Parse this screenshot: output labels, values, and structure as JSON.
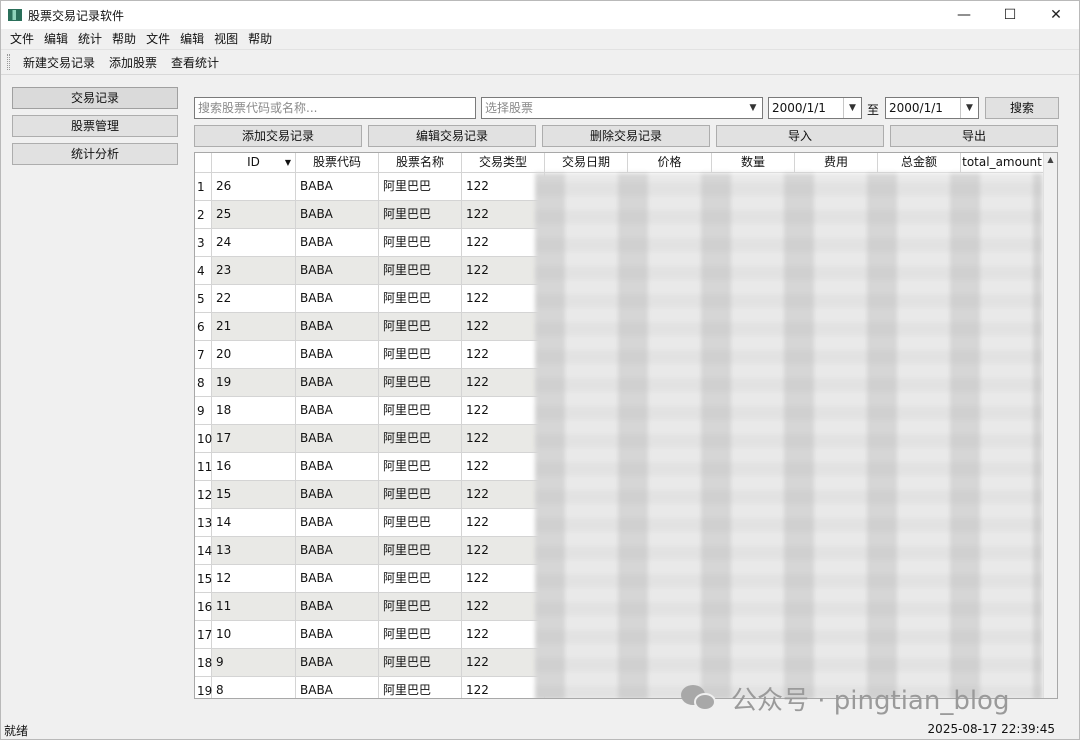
{
  "window": {
    "title": "股票交易记录软件",
    "minimize": "—",
    "maximize": "☐",
    "close": "✕"
  },
  "menubar": [
    "文件",
    "编辑",
    "统计",
    "帮助",
    "文件",
    "编辑",
    "视图",
    "帮助"
  ],
  "toolbar": [
    "新建交易记录",
    "添加股票",
    "查看统计"
  ],
  "sidebar": [
    "交易记录",
    "股票管理",
    "统计分析"
  ],
  "search": {
    "placeholder": "搜索股票代码或名称...",
    "stock_select_placeholder": "选择股票",
    "date_from": "2000/1/1",
    "to_label": "至",
    "date_to": "2000/1/1",
    "search_button": "搜索"
  },
  "actions": [
    "添加交易记录",
    "编辑交易记录",
    "删除交易记录",
    "导入",
    "导出"
  ],
  "table": {
    "columns": [
      "ID",
      "股票代码",
      "股票名称",
      "交易类型",
      "交易日期",
      "价格",
      "数量",
      "费用",
      "总金额",
      "total_amount"
    ],
    "sort_indicator": "▼",
    "rows": [
      {
        "n": "1",
        "id": "26",
        "code": "BABA",
        "name": "阿里巴巴",
        "type": "122"
      },
      {
        "n": "2",
        "id": "25",
        "code": "BABA",
        "name": "阿里巴巴",
        "type": "122"
      },
      {
        "n": "3",
        "id": "24",
        "code": "BABA",
        "name": "阿里巴巴",
        "type": "122"
      },
      {
        "n": "4",
        "id": "23",
        "code": "BABA",
        "name": "阿里巴巴",
        "type": "122"
      },
      {
        "n": "5",
        "id": "22",
        "code": "BABA",
        "name": "阿里巴巴",
        "type": "122"
      },
      {
        "n": "6",
        "id": "21",
        "code": "BABA",
        "name": "阿里巴巴",
        "type": "122"
      },
      {
        "n": "7",
        "id": "20",
        "code": "BABA",
        "name": "阿里巴巴",
        "type": "122"
      },
      {
        "n": "8",
        "id": "19",
        "code": "BABA",
        "name": "阿里巴巴",
        "type": "122"
      },
      {
        "n": "9",
        "id": "18",
        "code": "BABA",
        "name": "阿里巴巴",
        "type": "122"
      },
      {
        "n": "10",
        "id": "17",
        "code": "BABA",
        "name": "阿里巴巴",
        "type": "122"
      },
      {
        "n": "11",
        "id": "16",
        "code": "BABA",
        "name": "阿里巴巴",
        "type": "122"
      },
      {
        "n": "12",
        "id": "15",
        "code": "BABA",
        "name": "阿里巴巴",
        "type": "122"
      },
      {
        "n": "13",
        "id": "14",
        "code": "BABA",
        "name": "阿里巴巴",
        "type": "122"
      },
      {
        "n": "14",
        "id": "13",
        "code": "BABA",
        "name": "阿里巴巴",
        "type": "122"
      },
      {
        "n": "15",
        "id": "12",
        "code": "BABA",
        "name": "阿里巴巴",
        "type": "122"
      },
      {
        "n": "16",
        "id": "11",
        "code": "BABA",
        "name": "阿里巴巴",
        "type": "122"
      },
      {
        "n": "17",
        "id": "10",
        "code": "BABA",
        "name": "阿里巴巴",
        "type": "122"
      },
      {
        "n": "18",
        "id": "9",
        "code": "BABA",
        "name": "阿里巴巴",
        "type": "122"
      },
      {
        "n": "19",
        "id": "8",
        "code": "BABA",
        "name": "阿里巴巴",
        "type": "122"
      }
    ]
  },
  "status": {
    "left": "就绪",
    "right": "2025-08-17 22:39:45"
  },
  "watermark": "公众号 · pingtian_blog",
  "icons": {
    "app": "app-icon",
    "dropdown": "chevron-down-icon",
    "wechat": "wechat-icon"
  },
  "colors": {
    "row_alt": "#e9e9e6",
    "button_bg": "#e1e1e1",
    "window_bg": "#f0f0f0"
  }
}
